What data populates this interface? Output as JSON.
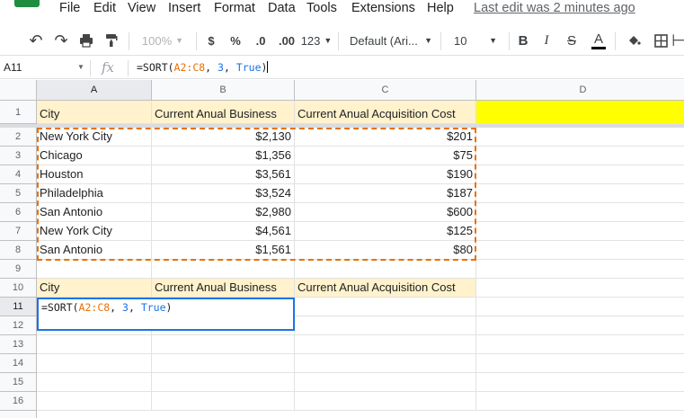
{
  "menu": {
    "items": [
      "File",
      "Edit",
      "View",
      "Insert",
      "Format",
      "Data",
      "Tools",
      "Extensions",
      "Help"
    ],
    "last_edit": "Last edit was 2 minutes ago"
  },
  "toolbar": {
    "zoom": "100%",
    "currency": "$",
    "percent": "%",
    "dec_decrease": ".0",
    "dec_increase": ".00",
    "more_formats": "123",
    "font": "Default (Ari...",
    "font_size": "10",
    "bold": "B",
    "italic": "I",
    "strike": "S",
    "text_color": "A"
  },
  "formula_bar": {
    "name_box": "A11",
    "fx": "fx",
    "formula": {
      "prefix": "=SORT(",
      "range": "A2:C8",
      "sep1": ", ",
      "col": "3",
      "sep2": ", ",
      "flag": "True",
      "suffix": ")"
    }
  },
  "columns": [
    "A",
    "B",
    "C",
    "D"
  ],
  "rows": [
    "1",
    "2",
    "3",
    "4",
    "5",
    "6",
    "7",
    "8",
    "9",
    "10",
    "11",
    "12",
    "13",
    "14",
    "15",
    "16"
  ],
  "headers": {
    "city": "City",
    "business": "Current Anual Business",
    "cost": "Current Anual Acquisition Cost"
  },
  "data_rows": [
    {
      "city": "New York City",
      "business": "$2,130",
      "cost": "$201"
    },
    {
      "city": "Chicago",
      "business": "$1,356",
      "cost": "$75"
    },
    {
      "city": "Houston",
      "business": "$3,561",
      "cost": "$190"
    },
    {
      "city": "Philadelphia",
      "business": "$3,524",
      "cost": "$187"
    },
    {
      "city": "San Antonio",
      "business": "$2,980",
      "cost": "$600"
    },
    {
      "city": "New York City",
      "business": "$4,561",
      "cost": "$125"
    },
    {
      "city": "San Antonio",
      "business": "$1,561",
      "cost": "$80"
    }
  ],
  "colors": {
    "header_fill": "#fff2cc",
    "highlight_fill": "#ffff00",
    "range_dash": "#e8710a",
    "active_border": "#1a73e8"
  }
}
